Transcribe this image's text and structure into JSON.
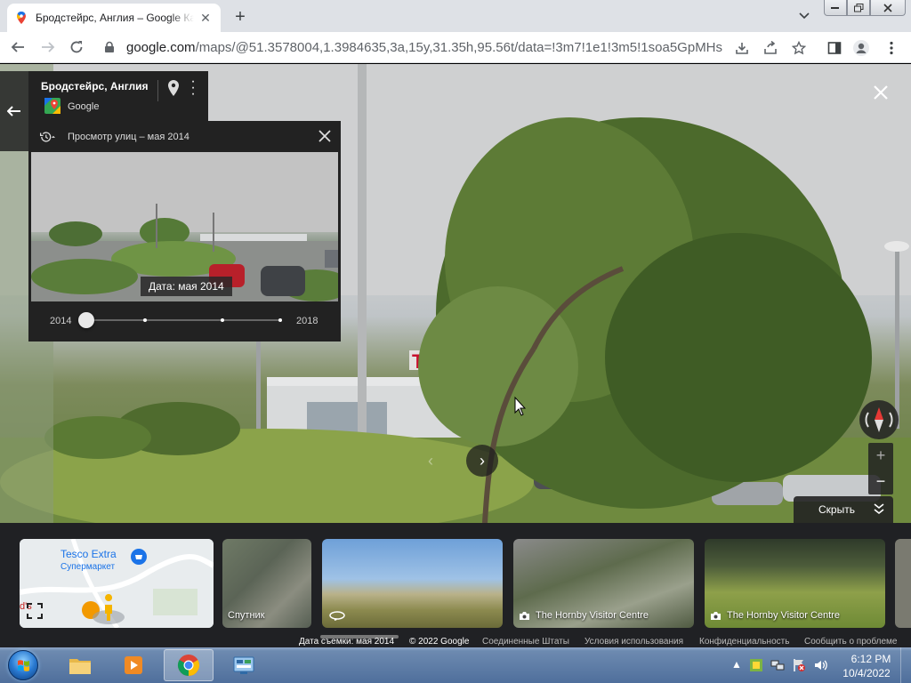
{
  "browser": {
    "tab_title": "Бродстейрс, Англия – Google Карты",
    "tab_close": "✕",
    "new_tab": "+",
    "url_host": "google.com",
    "url_path": "/maps/@51.3578004,1.3984635,3a,15y,31.35h,95.56t/data=!3m7!1e1!3m5!1soa5GpMHshpd__y..."
  },
  "place": {
    "name": "Бродстейрс, Англия",
    "provider": "Google"
  },
  "time_machine": {
    "header": "Просмотр улиц – мая 2014",
    "date_label": "Дата: мая 2014",
    "year_start": "2014",
    "year_end": "2018",
    "selected_index": 0,
    "stops": 4
  },
  "controls": {
    "hide_label": "Скрыть",
    "zoom_in": "+",
    "zoom_out": "−"
  },
  "carousel": {
    "map_card": {
      "title": "Tesco Extra",
      "subtitle": "Супермаркет",
      "poi": "d's"
    },
    "satellite_label": "Спутник",
    "photo1_label": "The Hornby Visitor Centre",
    "photo2_label": "The Hornby Visitor Centre"
  },
  "credits": {
    "capture_date": "Дата съемки: мая 2014",
    "copyright": "© 2022 Google",
    "country": "Соединенные Штаты",
    "terms": "Условия использования",
    "privacy": "Конфиденциальность",
    "report": "Сообщить о проблеме"
  },
  "taskbar": {
    "time": "6:12 PM",
    "date": "10/4/2022"
  },
  "colors": {
    "panel_bg": "#222222",
    "carousel_bg": "#202124",
    "link_blue": "#1a73e8"
  }
}
